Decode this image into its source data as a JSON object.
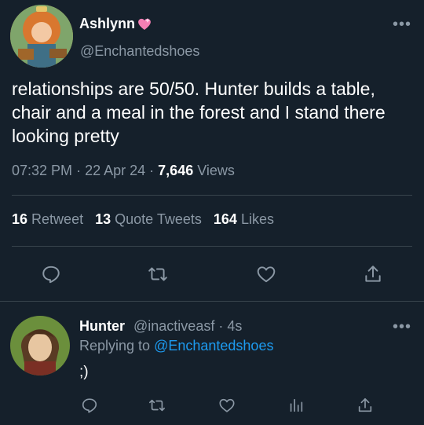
{
  "main_tweet": {
    "display_name": "Ashlynn",
    "handle": "@Enchantedshoes",
    "text": "relationships are 50/50. Hunter builds a table, chair and a meal in the forest and I stand there looking pretty",
    "time": "07:32 PM",
    "date": "22 Apr 24",
    "views_count": "7,646",
    "views_label": "Views",
    "separator": "·",
    "retweets_count": "16",
    "retweets_label": "Retweet",
    "quotes_count": "13",
    "quotes_label": "Quote Tweets",
    "likes_count": "164",
    "likes_label": "Likes"
  },
  "reply": {
    "display_name": "Hunter",
    "handle": "@inactiveasf",
    "age": "4s",
    "separator": "·",
    "replying_prefix": "Replying to",
    "replying_handle": "@Enchantedshoes",
    "text": ";)"
  },
  "icons": {
    "more": "more-icon",
    "heart_badge": "sparkling-heart-icon",
    "reply": "reply-icon",
    "retweet": "retweet-icon",
    "like": "like-icon",
    "share": "share-icon",
    "analytics": "analytics-icon"
  },
  "colors": {
    "background": "#15202b",
    "accent": "#1d9bf0",
    "muted": "#8b98a5",
    "divider": "#38444d",
    "heart_badge": "#f47fb4"
  }
}
